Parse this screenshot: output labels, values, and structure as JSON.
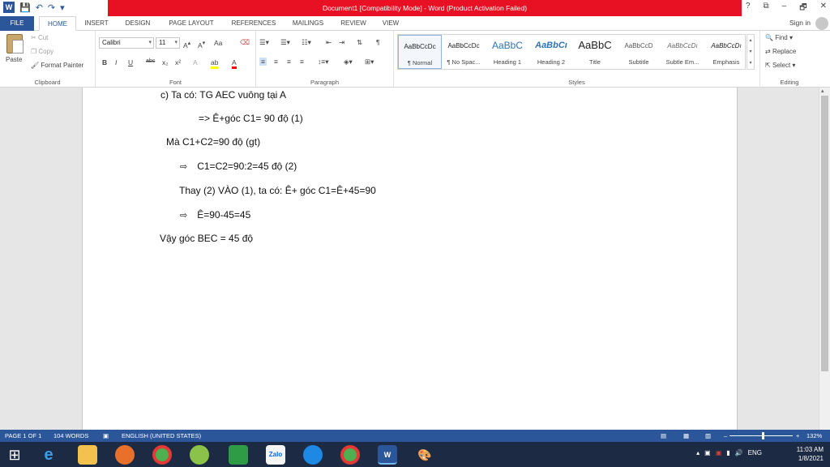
{
  "title_bar": {
    "title": "Document1 [Compatibility Mode] - Word (Product Activation Failed)",
    "controls": [
      "?",
      "⧉",
      "–",
      "🗗",
      "✕"
    ]
  },
  "tabs": [
    {
      "label": "FILE"
    },
    {
      "label": "HOME"
    },
    {
      "label": "INSERT"
    },
    {
      "label": "DESIGN"
    },
    {
      "label": "PAGE LAYOUT"
    },
    {
      "label": "REFERENCES"
    },
    {
      "label": "MAILINGS"
    },
    {
      "label": "REVIEW"
    },
    {
      "label": "VIEW"
    }
  ],
  "account": {
    "signin": "Sign in"
  },
  "ribbon": {
    "clipboard": {
      "paste": "Paste",
      "cut": "Cut",
      "copy": "Copy",
      "format_painter": "Format Painter",
      "label": "Clipboard"
    },
    "font": {
      "name": "Calibri",
      "size": "11",
      "label": "Font",
      "case": "Aa",
      "bold": "B",
      "italic": "I",
      "underline": "U",
      "strike": "abc",
      "sub": "x₂",
      "sup": "x²"
    },
    "paragraph": {
      "label": "Paragraph"
    },
    "styles": {
      "label": "Styles",
      "items": [
        {
          "sample": "AaBbCcDc",
          "name": "¶ Normal"
        },
        {
          "sample": "AaBbCcDc",
          "name": "¶ No Spac..."
        },
        {
          "sample": "AaBbC",
          "name": "Heading 1"
        },
        {
          "sample": "AaBbCı",
          "name": "Heading 2"
        },
        {
          "sample": "AaBbC",
          "name": "Title"
        },
        {
          "sample": "AaBbCcD",
          "name": "Subtitle"
        },
        {
          "sample": "AaBbCcDı",
          "name": "Subtle Em..."
        },
        {
          "sample": "AaBbCcDı",
          "name": "Emphasis"
        }
      ]
    },
    "editing": {
      "find": "Find",
      "replace": "Replace",
      "select": "Select",
      "label": "Editing"
    }
  },
  "document": {
    "lines": [
      "c) Ta có: TG AEC vuông tại A",
      "=> Ê+góc C1= 90 độ (1)",
      "Mà C1+C2=90 độ (gt)",
      "C1=C2=90:2=45 độ (2)",
      "Thay (2) VÀO (1), ta có: Ê+ góc C1=Ê+45=90",
      "Ê=90-45=45",
      "Vậy góc BEC = 45 độ"
    ],
    "bullet": "⇨"
  },
  "status_bar": {
    "page": "PAGE 1 OF 1",
    "words": "104 WORDS",
    "language": "ENGLISH (UNITED STATES)",
    "zoom": "132%"
  },
  "taskbar": {
    "lang": "ENG",
    "time": "11:03 AM",
    "date": "1/8/2021",
    "zalo_label": "Zalo"
  },
  "colors": {
    "word_blue": "#2b579a",
    "alert_red": "#e81123",
    "taskbar": "#1c2a44"
  }
}
